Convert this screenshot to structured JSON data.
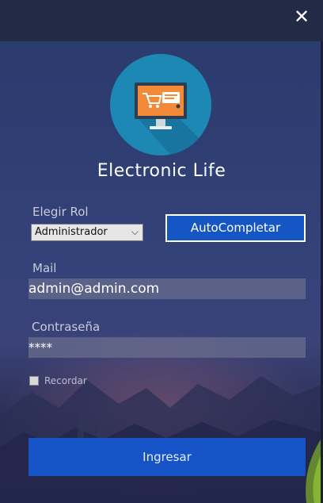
{
  "window": {
    "close_icon": "close-icon",
    "close_glyph": "✕"
  },
  "app": {
    "title": "Electronic Life",
    "logo_icon": "computer-cart-icon"
  },
  "role": {
    "label": "Elegir Rol",
    "selected": "Administrador"
  },
  "autocomplete": {
    "label": "AutoCompletar"
  },
  "mail": {
    "label": "Mail",
    "value": "admin@admin.com"
  },
  "password": {
    "label": "Contraseña",
    "value": "****"
  },
  "remember": {
    "label": "Recordar",
    "checked": false
  },
  "login": {
    "label": "Ingresar"
  },
  "colors": {
    "accent": "#1656c4",
    "logo_circle": "#1e88b4",
    "screen_orange": "#f28a3a"
  }
}
